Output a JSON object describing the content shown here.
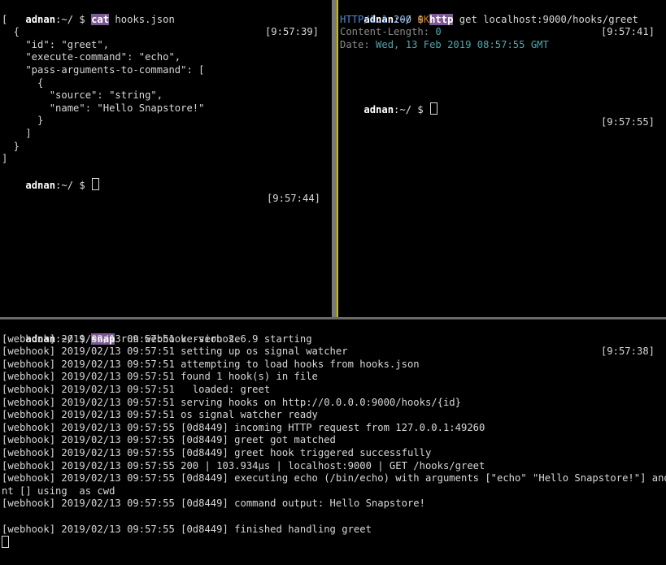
{
  "tl": {
    "prompt_user": "adnan",
    "prompt_path": ":~/ $ ",
    "command": "cat",
    "args": " hooks.json",
    "time": "[9:57:39]",
    "json_lines": [
      "[",
      "  {",
      "    \"id\": \"greet\",",
      "    \"execute-command\": \"echo\",",
      "    \"pass-arguments-to-command\": [",
      "      {",
      "        \"source\": \"string\",",
      "        \"name\": \"Hello Snapstore!\"",
      "      }",
      "    ]",
      "  }",
      "]"
    ],
    "prompt2_user": "adnan",
    "prompt2_path": ":~/ $ ",
    "time2": "[9:57:44]"
  },
  "tr": {
    "prompt_user": "adnan",
    "prompt_path": ":~/ $ ",
    "command": "http",
    "args": " get localhost:9000/hooks/greet",
    "time": "[9:57:41]",
    "resp_http": "HTTP/",
    "resp_version": "1.1",
    "resp_status_code": " 200",
    "resp_status_text": " OK",
    "cl_key": "Content-Length",
    "cl_sep": ": ",
    "cl_val": "0",
    "date_key": "Date",
    "date_sep": ": ",
    "date_val": "Wed, 13 Feb 2019 08:57:55 GMT",
    "prompt2_user": "adnan",
    "prompt2_path": ":~/ $ ",
    "time2": "[9:57:55]"
  },
  "bottom": {
    "prompt_user": "adnan",
    "prompt_path": ":~/ $ ",
    "command": "snap",
    "args": " run webhook -verbose",
    "time": "[9:57:38]",
    "log_lines": [
      "[webhook] 2019/02/13 09:57:51 version 2.6.9 starting",
      "[webhook] 2019/02/13 09:57:51 setting up os signal watcher",
      "[webhook] 2019/02/13 09:57:51 attempting to load hooks from hooks.json",
      "[webhook] 2019/02/13 09:57:51 found 1 hook(s) in file",
      "[webhook] 2019/02/13 09:57:51   loaded: greet",
      "[webhook] 2019/02/13 09:57:51 serving hooks on http://0.0.0.0:9000/hooks/{id}",
      "[webhook] 2019/02/13 09:57:51 os signal watcher ready",
      "[webhook] 2019/02/13 09:57:55 [0d8449] incoming HTTP request from 127.0.0.1:49260",
      "[webhook] 2019/02/13 09:57:55 [0d8449] greet got matched",
      "[webhook] 2019/02/13 09:57:55 [0d8449] greet hook triggered successfully",
      "[webhook] 2019/02/13 09:57:55 200 | 103.934µs | localhost:9000 | GET /hooks/greet",
      "[webhook] 2019/02/13 09:57:55 [0d8449] executing echo (/bin/echo) with arguments [\"echo\" \"Hello Snapstore!\"] and environme",
      "nt [] using  as cwd",
      "[webhook] 2019/02/13 09:57:55 [0d8449] command output: Hello Snapstore!",
      "",
      "[webhook] 2019/02/13 09:57:55 [0d8449] finished handling greet"
    ]
  },
  "colors": {
    "background": "#000000",
    "text": "#d8d8d8",
    "command_highlight": "#7e5a93",
    "http_blue": "#4e8ad9",
    "status_orange": "#d77a00",
    "value_teal": "#4aa7ad",
    "active_pane_border": "#c7bd00"
  }
}
